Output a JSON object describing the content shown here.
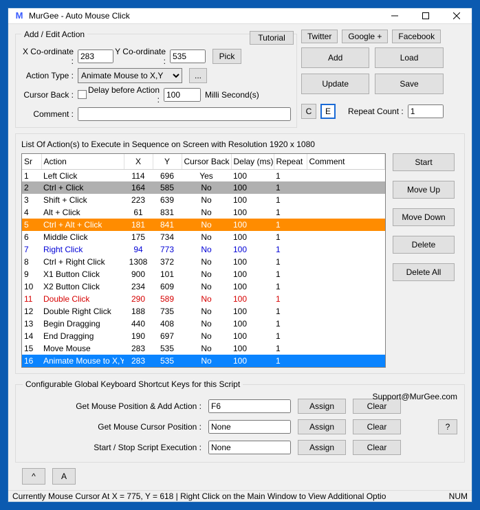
{
  "window": {
    "title": "MurGee - Auto Mouse Click"
  },
  "links": {
    "tutorial": "Tutorial",
    "twitter": "Twitter",
    "google": "Google +",
    "facebook": "Facebook"
  },
  "addedit": {
    "legend": "Add / Edit Action",
    "x_label": "X Co-ordinate :",
    "x_value": "283",
    "y_label": "Y Co-ordinate :",
    "y_value": "535",
    "pick": "Pick",
    "type_label": "Action Type :",
    "type_value": "Animate Mouse to X,Y",
    "more": "...",
    "cursor_back_label": "Cursor Back :",
    "delay_label": "Delay before Action :",
    "delay_value": "100",
    "delay_unit": "Milli Second(s)",
    "comment_label": "Comment :",
    "comment_value": ""
  },
  "ce": {
    "c": "C",
    "e": "E"
  },
  "mainbtns": {
    "add": "Add",
    "load": "Load",
    "update": "Update",
    "save": "Save"
  },
  "repeat": {
    "label": "Repeat Count :",
    "value": "1"
  },
  "list": {
    "desc": "List Of Action(s) to Execute in Sequence on Screen with Resolution 1920 x 1080",
    "headers": {
      "sr": "Sr",
      "action": "Action",
      "x": "X",
      "y": "Y",
      "cb": "Cursor Back",
      "delay": "Delay (ms)",
      "repeat": "Repeat",
      "comment": "Comment"
    },
    "rows": [
      {
        "sr": "1",
        "action": "Left Click",
        "x": "114",
        "y": "696",
        "cb": "Yes",
        "delay": "100",
        "repeat": "1",
        "comment": "",
        "style": "n"
      },
      {
        "sr": "2",
        "action": "Ctrl + Click",
        "x": "164",
        "y": "585",
        "cb": "No",
        "delay": "100",
        "repeat": "1",
        "comment": "",
        "style": "g"
      },
      {
        "sr": "3",
        "action": "Shift + Click",
        "x": "223",
        "y": "639",
        "cb": "No",
        "delay": "100",
        "repeat": "1",
        "comment": "",
        "style": "n"
      },
      {
        "sr": "4",
        "action": "Alt + Click",
        "x": "61",
        "y": "831",
        "cb": "No",
        "delay": "100",
        "repeat": "1",
        "comment": "",
        "style": "n"
      },
      {
        "sr": "5",
        "action": "Ctrl + Alt + Click",
        "x": "181",
        "y": "841",
        "cb": "No",
        "delay": "100",
        "repeat": "1",
        "comment": "",
        "style": "o"
      },
      {
        "sr": "6",
        "action": "Middle Click",
        "x": "175",
        "y": "734",
        "cb": "No",
        "delay": "100",
        "repeat": "1",
        "comment": "",
        "style": "n"
      },
      {
        "sr": "7",
        "action": "Right Click",
        "x": "94",
        "y": "773",
        "cb": "No",
        "delay": "100",
        "repeat": "1",
        "comment": "",
        "style": "b"
      },
      {
        "sr": "8",
        "action": "Ctrl + Right Click",
        "x": "1308",
        "y": "372",
        "cb": "No",
        "delay": "100",
        "repeat": "1",
        "comment": "",
        "style": "n"
      },
      {
        "sr": "9",
        "action": "X1 Button Click",
        "x": "900",
        "y": "101",
        "cb": "No",
        "delay": "100",
        "repeat": "1",
        "comment": "",
        "style": "n"
      },
      {
        "sr": "10",
        "action": "X2 Button Click",
        "x": "234",
        "y": "609",
        "cb": "No",
        "delay": "100",
        "repeat": "1",
        "comment": "",
        "style": "n"
      },
      {
        "sr": "11",
        "action": "Double Click",
        "x": "290",
        "y": "589",
        "cb": "No",
        "delay": "100",
        "repeat": "1",
        "comment": "",
        "style": "r"
      },
      {
        "sr": "12",
        "action": "Double Right Click",
        "x": "188",
        "y": "735",
        "cb": "No",
        "delay": "100",
        "repeat": "1",
        "comment": "",
        "style": "n"
      },
      {
        "sr": "13",
        "action": "Begin Dragging",
        "x": "440",
        "y": "408",
        "cb": "No",
        "delay": "100",
        "repeat": "1",
        "comment": "",
        "style": "n"
      },
      {
        "sr": "14",
        "action": "End Dragging",
        "x": "190",
        "y": "697",
        "cb": "No",
        "delay": "100",
        "repeat": "1",
        "comment": "",
        "style": "n"
      },
      {
        "sr": "15",
        "action": "Move Mouse",
        "x": "283",
        "y": "535",
        "cb": "No",
        "delay": "100",
        "repeat": "1",
        "comment": "",
        "style": "n"
      },
      {
        "sr": "16",
        "action": "Animate Mouse to X,Y",
        "x": "283",
        "y": "535",
        "cb": "No",
        "delay": "100",
        "repeat": "1",
        "comment": "",
        "style": "s"
      }
    ]
  },
  "rowbtns": {
    "start": "Start",
    "up": "Move Up",
    "down": "Move Down",
    "del": "Delete",
    "delall": "Delete All"
  },
  "shortcuts": {
    "legend": "Configurable Global Keyboard Shortcut Keys for this Script",
    "support": "Support@MurGee.com",
    "r1_label": "Get Mouse Position & Add Action :",
    "r1_value": "F6",
    "r2_label": "Get Mouse Cursor Position :",
    "r2_value": "None",
    "r3_label": "Start / Stop Script Execution :",
    "r3_value": "None",
    "assign": "Assign",
    "clear": "Clear",
    "help": "?"
  },
  "bottom": {
    "caret": "^",
    "a": "A"
  },
  "status": {
    "text": "Currently Mouse Cursor At X = 775, Y = 618 | Right Click on the Main Window to View Additional Optio",
    "num": "NUM"
  }
}
